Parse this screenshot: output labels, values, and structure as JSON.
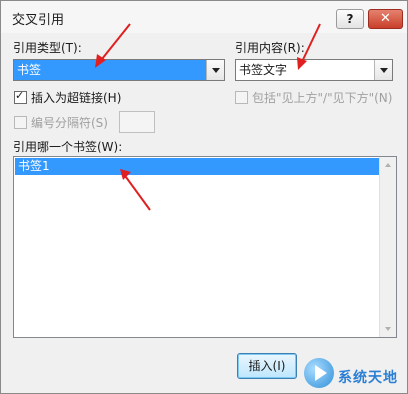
{
  "dialog": {
    "title": "交叉引用",
    "help_button": "?",
    "close_button": "✕"
  },
  "reference_type": {
    "label": "引用类型(T):",
    "value": "书签"
  },
  "reference_content": {
    "label": "引用内容(R):",
    "value": "书签文字"
  },
  "options": {
    "insert_as_hyperlink": {
      "label": "插入为超链接(H)",
      "checked": true
    },
    "include_above_below": {
      "label": "包括\"见上方\"/\"见下方\"(N)",
      "checked": false,
      "disabled": true
    },
    "separate_numbers": {
      "label": "编号分隔符(S)",
      "checked": false,
      "disabled": true
    }
  },
  "bookmark_list": {
    "label": "引用哪一个书签(W):",
    "items": [
      "书签1"
    ],
    "selected": "书签1"
  },
  "buttons": {
    "insert": "插入(I)"
  },
  "watermark": {
    "text": "系统天地"
  },
  "colors": {
    "selection": "#3399ff",
    "annotation_arrow": "#e02020",
    "close_button": "#c9402a"
  }
}
